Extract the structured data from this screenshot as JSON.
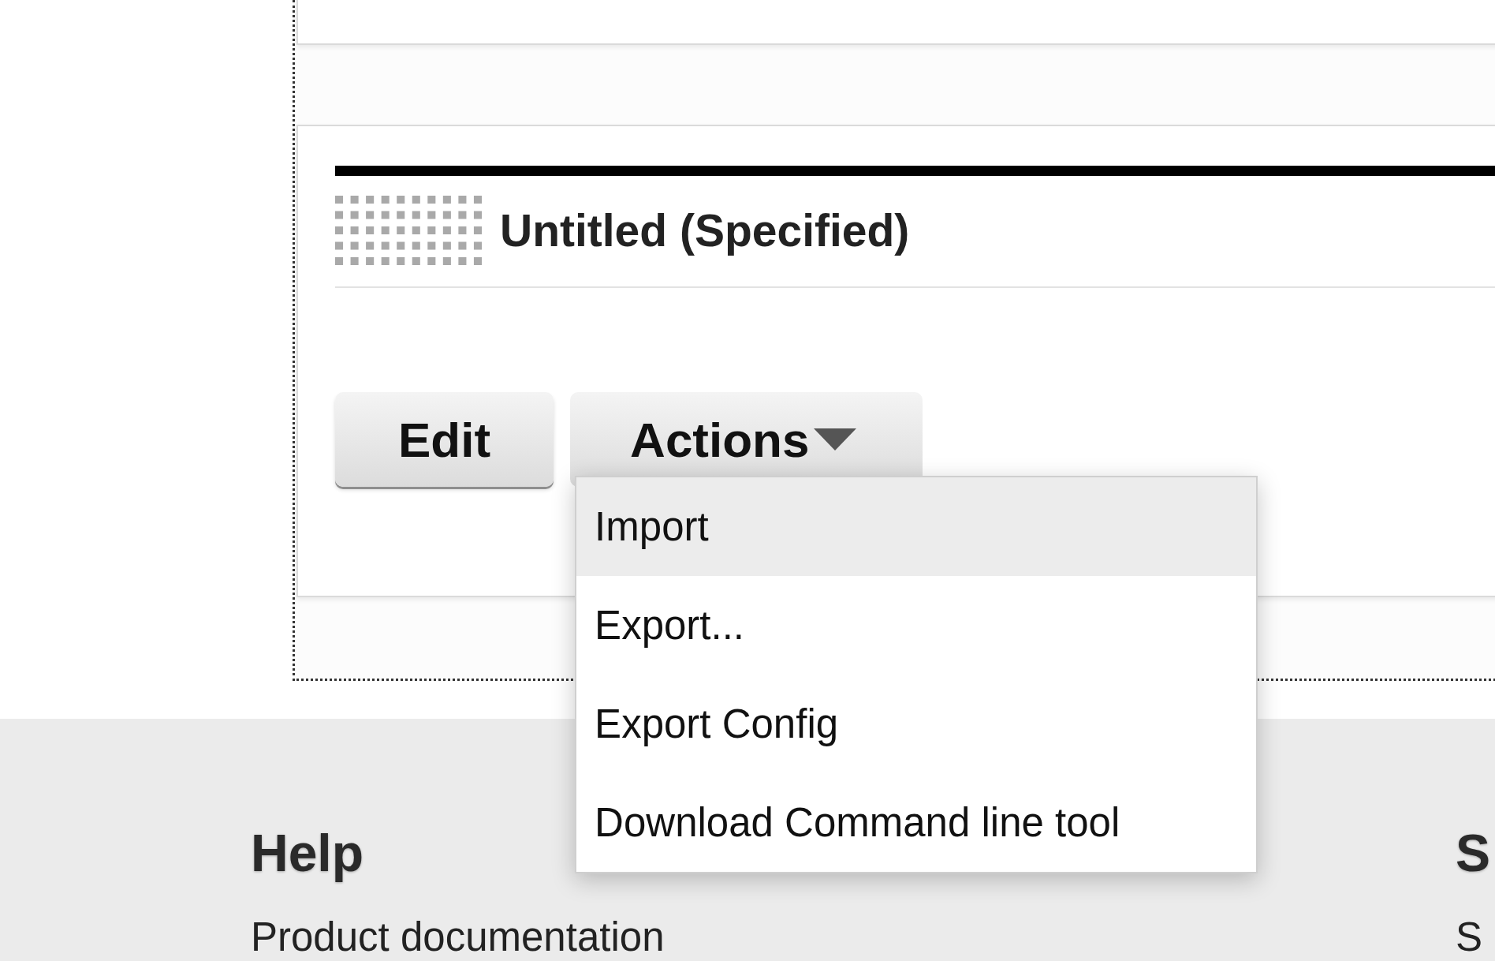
{
  "panel": {
    "title": "Untitled (Specified)",
    "buttons": [
      {
        "label": "Edit",
        "kind": "plain"
      },
      {
        "label": "Actions",
        "kind": "dropdown",
        "expanded": true
      }
    ]
  },
  "actions_menu": {
    "items": [
      {
        "label": "Import",
        "selected": true
      },
      {
        "label": "Export...",
        "selected": false
      },
      {
        "label": "Export Config",
        "selected": false
      },
      {
        "label": "Download Command line tool",
        "selected": false
      }
    ]
  },
  "footer": {
    "columns": [
      {
        "heading": "Help",
        "links": [
          "Product documentation"
        ]
      },
      {
        "heading": "S",
        "links": [
          "S"
        ]
      }
    ]
  }
}
